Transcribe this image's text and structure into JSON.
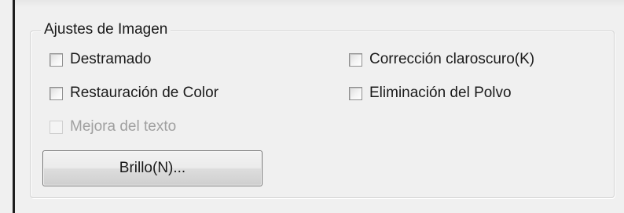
{
  "group": {
    "title": "Ajustes de Imagen"
  },
  "options": {
    "descreening": {
      "label": "Destramado",
      "checked": false,
      "enabled": true
    },
    "color_restoration": {
      "label": "Restauración de Color",
      "checked": false,
      "enabled": true
    },
    "text_enhancement": {
      "label": "Mejora del texto",
      "checked": false,
      "enabled": false
    },
    "backlight_correction": {
      "label": "Corrección claroscuro(K)",
      "checked": false,
      "enabled": true
    },
    "dust_removal": {
      "label": "Eliminación del Polvo",
      "checked": false,
      "enabled": true
    }
  },
  "brightness_button": {
    "label": "Brillo(N)..."
  }
}
